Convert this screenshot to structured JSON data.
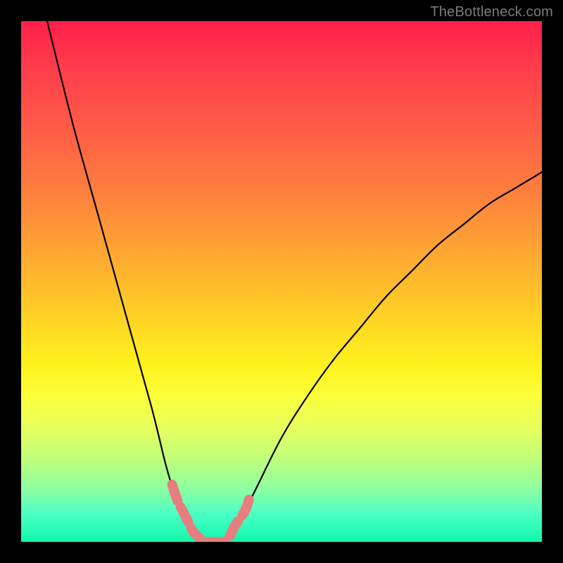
{
  "watermark": "TheBottleneck.com",
  "chart_data": {
    "type": "line",
    "title": "",
    "xlabel": "",
    "ylabel": "",
    "xlim": [
      0,
      100
    ],
    "ylim": [
      0,
      100
    ],
    "background_gradient": {
      "top": "#ff1f4b",
      "mid": "#fff21e",
      "bottom": "#10f7ac"
    },
    "series": [
      {
        "name": "bottleneck-curve",
        "color": "#000000",
        "x": [
          5,
          10,
          15,
          20,
          25,
          28,
          30,
          32,
          33,
          34,
          35,
          36,
          37,
          38,
          39,
          40,
          42,
          45,
          50,
          55,
          60,
          65,
          70,
          75,
          80,
          85,
          90,
          95,
          100
        ],
        "y": [
          100,
          80,
          62,
          44,
          26,
          14,
          8,
          4,
          2,
          1,
          0,
          0,
          0,
          0,
          0,
          1,
          4,
          10,
          20,
          28,
          35,
          41,
          47,
          52,
          57,
          61,
          65,
          68,
          71
        ]
      },
      {
        "name": "highlight-band",
        "color": "#e77d7d",
        "x": [
          29,
          30,
          31,
          32,
          33,
          34,
          35,
          36,
          37,
          38,
          39,
          40,
          41,
          43,
          44
        ],
        "y": [
          11,
          8,
          6,
          4,
          2,
          1,
          0,
          0,
          0,
          0,
          0,
          1,
          3,
          6,
          9
        ]
      }
    ],
    "annotations": []
  }
}
